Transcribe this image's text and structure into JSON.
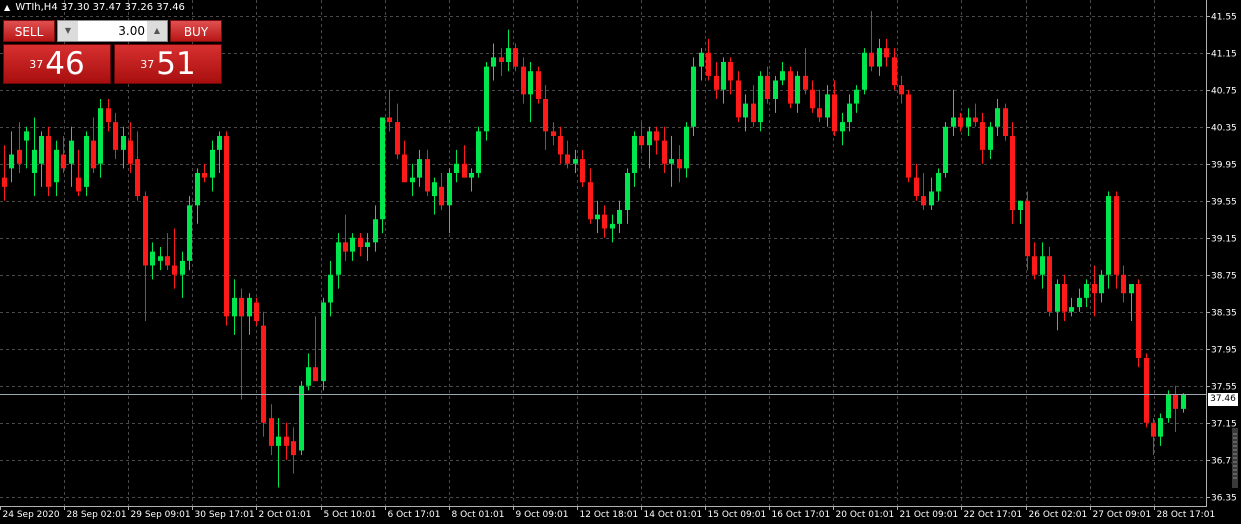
{
  "header": {
    "symbol": "WTIh,H4",
    "ohlc": "37.30 37.47 37.26 37.46"
  },
  "trade_panel": {
    "sell_label": "SELL",
    "buy_label": "BUY",
    "lot_value": "3.00",
    "sell_price_small": "37",
    "sell_price_big": "46",
    "buy_price_small": "37",
    "buy_price_big": "51"
  },
  "current_price_label": "37.46",
  "colors": {
    "background": "#000000",
    "grid": "#4a4a4a",
    "bull": "#00e64d",
    "bear": "#ff1a1a",
    "text": "#ffffff"
  },
  "chart_data": {
    "type": "candlestick",
    "title": "",
    "xlabel": "",
    "ylabel": "",
    "ylim": [
      36.25,
      41.72
    ],
    "y_ticks": [
      "41.55",
      "41.15",
      "40.75",
      "40.35",
      "39.95",
      "39.55",
      "39.15",
      "38.75",
      "38.35",
      "37.95",
      "37.55",
      "37.15",
      "36.75",
      "36.35"
    ],
    "x_tick_labels": [
      "24 Sep 2020",
      "28 Sep 02:01",
      "29 Sep 09:01",
      "30 Sep 17:01",
      "2 Oct 01:01",
      "5 Oct 10:01",
      "6 Oct 17:01",
      "8 Oct 01:01",
      "9 Oct 09:01",
      "12 Oct 18:01",
      "14 Oct 01:01",
      "15 Oct 09:01",
      "16 Oct 17:01",
      "20 Oct 01:01",
      "21 Oct 09:01",
      "22 Oct 17:01",
      "26 Oct 02:01",
      "27 Oct 09:01",
      "28 Oct 17:01"
    ],
    "current_price": 37.46,
    "grid": true,
    "ohlc": [
      [
        39.8,
        40.15,
        39.55,
        39.7
      ],
      [
        39.9,
        40.3,
        39.75,
        40.05
      ],
      [
        40.1,
        40.4,
        39.85,
        39.95
      ],
      [
        40.2,
        40.35,
        39.9,
        40.3
      ],
      [
        39.85,
        40.45,
        39.6,
        40.1
      ],
      [
        39.95,
        40.3,
        39.7,
        40.25
      ],
      [
        40.25,
        40.35,
        39.6,
        39.7
      ],
      [
        39.75,
        40.2,
        39.6,
        40.1
      ],
      [
        40.05,
        40.25,
        39.85,
        39.9
      ],
      [
        39.95,
        40.35,
        39.7,
        40.2
      ],
      [
        39.8,
        40.1,
        39.6,
        39.65
      ],
      [
        39.7,
        40.3,
        39.6,
        40.25
      ],
      [
        40.2,
        40.45,
        39.85,
        39.9
      ],
      [
        39.95,
        40.65,
        39.8,
        40.55
      ],
      [
        40.55,
        40.65,
        40.3,
        40.4
      ],
      [
        40.4,
        40.5,
        40.0,
        40.1
      ],
      [
        40.1,
        40.35,
        39.9,
        40.25
      ],
      [
        40.2,
        40.4,
        39.85,
        39.95
      ],
      [
        40.0,
        40.3,
        39.55,
        39.6
      ],
      [
        39.6,
        39.65,
        38.25,
        38.85
      ],
      [
        38.85,
        39.1,
        38.7,
        39.0
      ],
      [
        38.9,
        39.05,
        38.8,
        38.95
      ],
      [
        38.95,
        39.2,
        38.8,
        38.85
      ],
      [
        38.85,
        39.25,
        38.6,
        38.75
      ],
      [
        38.75,
        39.0,
        38.5,
        38.9
      ],
      [
        38.9,
        39.6,
        38.8,
        39.5
      ],
      [
        39.5,
        39.9,
        39.3,
        39.85
      ],
      [
        39.85,
        39.95,
        39.75,
        39.8
      ],
      [
        39.8,
        40.2,
        39.65,
        40.1
      ],
      [
        40.1,
        40.3,
        39.85,
        40.25
      ],
      [
        40.25,
        40.3,
        38.2,
        38.3
      ],
      [
        38.3,
        38.7,
        38.1,
        38.5
      ],
      [
        38.5,
        38.6,
        37.4,
        38.3
      ],
      [
        38.3,
        38.55,
        38.1,
        38.5
      ],
      [
        38.45,
        38.5,
        38.2,
        38.25
      ],
      [
        38.2,
        38.35,
        37.0,
        37.15
      ],
      [
        37.2,
        37.35,
        36.8,
        36.9
      ],
      [
        36.9,
        37.2,
        36.45,
        37.0
      ],
      [
        37.0,
        37.15,
        36.75,
        36.9
      ],
      [
        36.95,
        37.1,
        36.6,
        36.8
      ],
      [
        36.85,
        37.6,
        36.8,
        37.55
      ],
      [
        37.55,
        37.9,
        37.5,
        37.75
      ],
      [
        37.75,
        38.3,
        37.6,
        37.6
      ],
      [
        37.6,
        38.5,
        37.5,
        38.45
      ],
      [
        38.45,
        38.9,
        38.3,
        38.75
      ],
      [
        38.75,
        39.2,
        38.6,
        39.1
      ],
      [
        39.1,
        39.4,
        38.9,
        39.0
      ],
      [
        39.0,
        39.2,
        38.9,
        39.15
      ],
      [
        39.15,
        39.2,
        38.95,
        39.05
      ],
      [
        39.05,
        39.2,
        38.9,
        39.1
      ],
      [
        39.1,
        39.5,
        39.0,
        39.35
      ],
      [
        39.35,
        39.7,
        39.2,
        40.45
      ],
      [
        40.45,
        40.75,
        40.3,
        40.4
      ],
      [
        40.4,
        40.6,
        40.0,
        40.05
      ],
      [
        40.05,
        40.2,
        39.8,
        39.75
      ],
      [
        39.75,
        39.95,
        39.6,
        39.8
      ],
      [
        39.8,
        40.1,
        39.7,
        40.0
      ],
      [
        40.0,
        40.1,
        39.6,
        39.65
      ],
      [
        39.6,
        39.8,
        39.4,
        39.75
      ],
      [
        39.7,
        39.85,
        39.45,
        39.5
      ],
      [
        39.5,
        39.9,
        39.2,
        39.85
      ],
      [
        39.85,
        40.1,
        39.75,
        39.95
      ],
      [
        39.95,
        40.15,
        39.8,
        39.8
      ],
      [
        39.8,
        39.9,
        39.65,
        39.85
      ],
      [
        39.85,
        40.35,
        39.8,
        40.3
      ],
      [
        40.3,
        41.05,
        40.2,
        41.0
      ],
      [
        41.0,
        41.25,
        40.85,
        41.1
      ],
      [
        41.1,
        41.2,
        40.9,
        41.05
      ],
      [
        41.05,
        41.4,
        40.95,
        41.2
      ],
      [
        41.2,
        41.25,
        40.95,
        41.0
      ],
      [
        41.0,
        41.1,
        40.6,
        40.7
      ],
      [
        40.7,
        41.05,
        40.4,
        40.95
      ],
      [
        40.95,
        41.0,
        40.6,
        40.65
      ],
      [
        40.65,
        40.8,
        40.1,
        40.3
      ],
      [
        40.3,
        40.4,
        40.15,
        40.25
      ],
      [
        40.25,
        40.35,
        39.95,
        40.05
      ],
      [
        40.05,
        40.2,
        39.9,
        39.95
      ],
      [
        39.95,
        40.1,
        39.85,
        40.0
      ],
      [
        40.0,
        40.1,
        39.7,
        39.75
      ],
      [
        39.75,
        39.9,
        39.3,
        39.35
      ],
      [
        39.35,
        39.55,
        39.2,
        39.4
      ],
      [
        39.4,
        39.5,
        39.15,
        39.25
      ],
      [
        39.25,
        39.4,
        39.1,
        39.3
      ],
      [
        39.3,
        39.55,
        39.2,
        39.45
      ],
      [
        39.45,
        39.9,
        39.3,
        39.85
      ],
      [
        39.85,
        40.3,
        39.7,
        40.25
      ],
      [
        40.25,
        40.4,
        40.1,
        40.15
      ],
      [
        40.15,
        40.35,
        39.9,
        40.3
      ],
      [
        40.3,
        40.35,
        40.05,
        40.2
      ],
      [
        40.2,
        40.35,
        39.85,
        39.95
      ],
      [
        39.95,
        40.25,
        39.7,
        40.0
      ],
      [
        40.0,
        40.15,
        39.75,
        39.9
      ],
      [
        39.9,
        40.4,
        39.8,
        40.35
      ],
      [
        40.35,
        41.1,
        40.25,
        41.0
      ],
      [
        41.0,
        41.2,
        40.85,
        41.15
      ],
      [
        41.15,
        41.3,
        40.85,
        40.9
      ],
      [
        40.9,
        41.05,
        40.65,
        40.75
      ],
      [
        40.75,
        41.1,
        40.6,
        41.05
      ],
      [
        41.05,
        41.1,
        40.7,
        40.85
      ],
      [
        40.85,
        40.95,
        40.4,
        40.45
      ],
      [
        40.45,
        40.7,
        40.3,
        40.6
      ],
      [
        40.6,
        40.8,
        40.35,
        40.4
      ],
      [
        40.4,
        40.95,
        40.3,
        40.9
      ],
      [
        40.9,
        41.0,
        40.6,
        40.65
      ],
      [
        40.65,
        40.9,
        40.5,
        40.85
      ],
      [
        40.85,
        41.05,
        40.8,
        40.95
      ],
      [
        40.95,
        41.0,
        40.55,
        40.6
      ],
      [
        40.6,
        40.95,
        40.5,
        40.9
      ],
      [
        40.9,
        41.2,
        40.7,
        40.75
      ],
      [
        40.75,
        40.85,
        40.5,
        40.55
      ],
      [
        40.55,
        40.75,
        40.4,
        40.45
      ],
      [
        40.45,
        40.8,
        40.35,
        40.7
      ],
      [
        40.7,
        40.85,
        40.25,
        40.3
      ],
      [
        40.3,
        40.5,
        40.15,
        40.4
      ],
      [
        40.4,
        40.7,
        40.3,
        40.6
      ],
      [
        40.6,
        40.8,
        40.5,
        40.75
      ],
      [
        40.75,
        41.2,
        40.7,
        41.15
      ],
      [
        41.15,
        41.6,
        40.95,
        41.0
      ],
      [
        41.0,
        41.3,
        40.9,
        41.2
      ],
      [
        41.2,
        41.3,
        41.0,
        41.1
      ],
      [
        41.1,
        41.2,
        40.75,
        40.8
      ],
      [
        40.8,
        40.9,
        40.6,
        40.7
      ],
      [
        40.7,
        40.75,
        39.75,
        39.8
      ],
      [
        39.8,
        39.95,
        39.55,
        39.6
      ],
      [
        39.6,
        39.85,
        39.45,
        39.5
      ],
      [
        39.5,
        39.8,
        39.45,
        39.65
      ],
      [
        39.65,
        39.9,
        39.55,
        39.85
      ],
      [
        39.85,
        40.4,
        39.8,
        40.35
      ],
      [
        40.35,
        40.75,
        40.25,
        40.45
      ],
      [
        40.45,
        40.5,
        40.3,
        40.35
      ],
      [
        40.35,
        40.55,
        40.25,
        40.45
      ],
      [
        40.45,
        40.6,
        40.35,
        40.4
      ],
      [
        40.4,
        40.5,
        39.95,
        40.1
      ],
      [
        40.1,
        40.4,
        40.0,
        40.35
      ],
      [
        40.35,
        40.65,
        40.25,
        40.55
      ],
      [
        40.55,
        40.6,
        40.2,
        40.25
      ],
      [
        40.25,
        40.4,
        39.3,
        39.45
      ],
      [
        39.45,
        39.55,
        39.3,
        39.55
      ],
      [
        39.55,
        39.65,
        38.8,
        38.95
      ],
      [
        38.95,
        39.1,
        38.7,
        38.75
      ],
      [
        38.75,
        39.1,
        38.6,
        38.95
      ],
      [
        38.95,
        39.05,
        38.3,
        38.35
      ],
      [
        38.35,
        38.7,
        38.15,
        38.65
      ],
      [
        38.65,
        38.75,
        38.25,
        38.35
      ],
      [
        38.35,
        38.5,
        38.3,
        38.4
      ],
      [
        38.4,
        38.6,
        38.35,
        38.5
      ],
      [
        38.5,
        38.7,
        38.4,
        38.65
      ],
      [
        38.65,
        38.85,
        38.3,
        38.55
      ],
      [
        38.55,
        38.8,
        38.45,
        38.75
      ],
      [
        38.75,
        39.65,
        38.6,
        39.6
      ],
      [
        39.6,
        39.65,
        38.6,
        38.75
      ],
      [
        38.75,
        38.85,
        38.45,
        38.55
      ],
      [
        38.55,
        38.65,
        38.25,
        38.65
      ],
      [
        38.65,
        38.7,
        37.75,
        37.85
      ],
      [
        37.85,
        37.9,
        37.1,
        37.15
      ],
      [
        37.15,
        37.2,
        36.8,
        37.0
      ],
      [
        37.0,
        37.25,
        36.9,
        37.2
      ],
      [
        37.2,
        37.5,
        37.15,
        37.45
      ],
      [
        37.45,
        37.55,
        37.05,
        37.3
      ],
      [
        37.3,
        37.47,
        37.26,
        37.46
      ]
    ]
  }
}
